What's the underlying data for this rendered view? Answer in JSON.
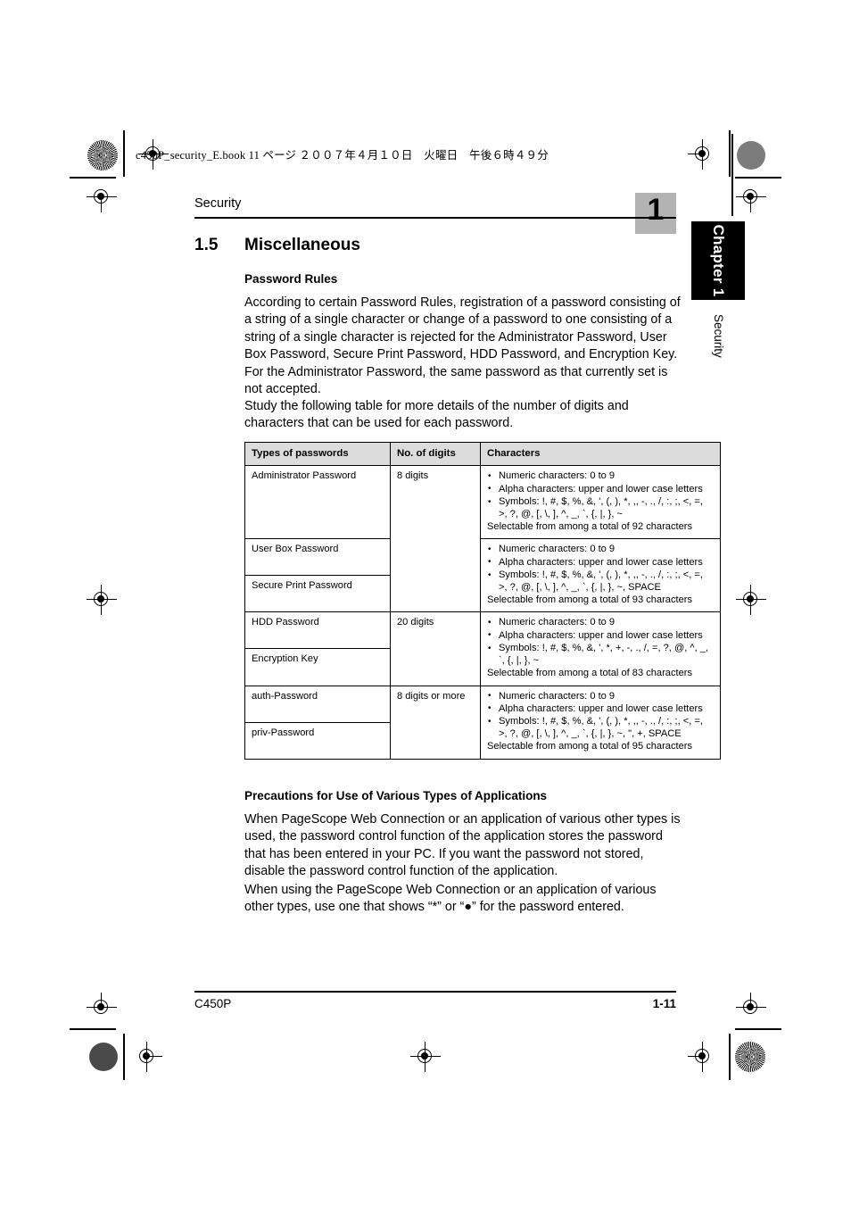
{
  "print_marks": {
    "book_line": "c450P_security_E.book   11 ページ   ２００７年４月１０日　火曜日　午後６時４９分"
  },
  "header": {
    "running_head": "Security",
    "chapter_number": "1",
    "chapter_tab": "Chapter 1",
    "side_label": "Security"
  },
  "section": {
    "number": "1.5",
    "title": "Miscellaneous"
  },
  "password_rules": {
    "heading": "Password Rules",
    "paragraph_1": "According to certain Password Rules, registration of a password consisting of a string of a single character or change of a password to one consisting of a string of a single character is rejected for the Administrator Password, User Box Password, Secure Print Password, HDD Password, and Encryption Key. For the Administrator Password, the same password as that currently set is not accepted.",
    "paragraph_2": "Study the following table for more details of the number of digits and characters that can be used for each password."
  },
  "table": {
    "headers": [
      "Types of passwords",
      "No. of digits",
      "Characters"
    ],
    "groups": [
      {
        "types": [
          "Administrator Password"
        ],
        "digits": "8 digits",
        "bullets": [
          "Numeric characters: 0 to 9",
          "Alpha characters: upper and lower case letters",
          "Symbols: !, #, $, %, &, ', (, ), *, ,, -, ., /, :, ;, <, =, >, ?, @, [, \\, ], ^, _, `, {, |, }, ~"
        ],
        "total": "Selectable from among a total of 92 characters"
      },
      {
        "types": [
          "User Box Password",
          "Secure Print Password"
        ],
        "digits": "",
        "bullets": [
          "Numeric characters: 0 to 9",
          "Alpha characters: upper and lower case letters",
          "Symbols: !, #, $, %, &, ', (, ), *, ,, -, ., /, :, ;, <, =, >, ?, @, [, \\, ], ^, _, `, {, |, }, ~, SPACE"
        ],
        "total": "Selectable from among a total of 93 characters"
      },
      {
        "types": [
          "HDD Password",
          "Encryption Key"
        ],
        "digits": "20 digits",
        "bullets": [
          "Numeric characters: 0 to 9",
          "Alpha characters: upper and lower case letters",
          "Symbols: !, #, $, %, &, ', *, +, -, ., /, =, ?, @, ^, _, `, {, |, }, ~"
        ],
        "total": "Selectable from among a total of 83 characters"
      },
      {
        "types": [
          "auth-Password",
          "priv-Password"
        ],
        "digits": "8 digits or more",
        "bullets": [
          "Numeric characters: 0 to 9",
          "Alpha characters: upper and lower case letters",
          "Symbols: !, #, $, %, &, ', (, ), *, ,, -, ., /, :, ;, <, =, >, ?, @, [, \\, ], ^, _, `, {, |, }, ~, \", +, SPACE"
        ],
        "total": "Selectable from among a total of 95 characters"
      }
    ]
  },
  "precautions": {
    "heading": "Precautions for Use of Various Types of Applications",
    "paragraph_1": "When PageScope Web Connection or an application of various other types is used, the password control function of the application stores the password that has been entered in your PC. If you want the password not stored, disable the password control function of the application.",
    "paragraph_2": "When using the PageScope Web Connection or an application of various other types, use one that shows “*” or “●” for the password entered."
  },
  "footer": {
    "left": "C450P",
    "right": "1-11"
  }
}
